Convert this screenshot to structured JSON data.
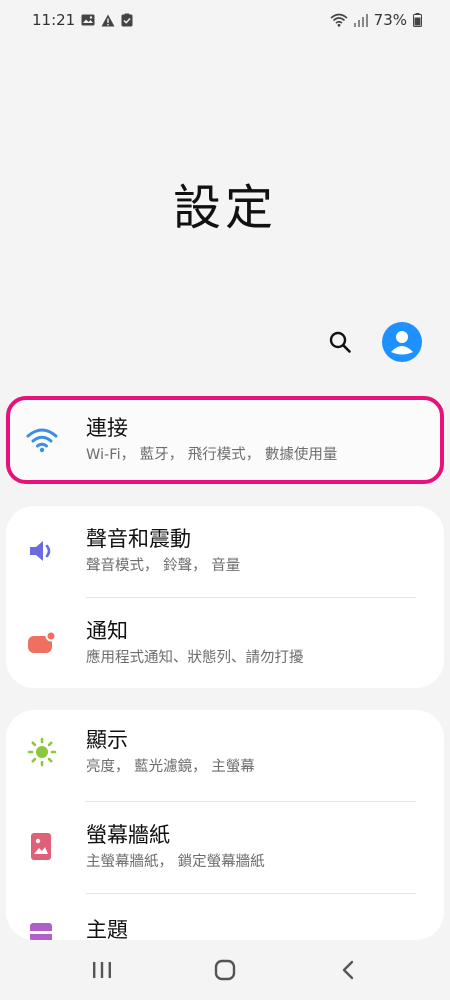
{
  "status_bar": {
    "time": "11:21",
    "left_icons": [
      "image-icon",
      "warning-icon",
      "clipboard-check-icon"
    ],
    "right_icons": [
      "wifi-icon",
      "signal-icon",
      "battery-icon"
    ],
    "battery": "73%"
  },
  "header": {
    "title": "設定"
  },
  "actions": {
    "search_icon": "search-icon",
    "profile_icon": "account-icon",
    "profile_color": "#1e90ff"
  },
  "settings": {
    "connections": {
      "title": "連接",
      "subtitle": "Wi-Fi， 藍牙， 飛行模式， 數據使用量",
      "icon": "wifi-icon",
      "icon_color": "#3a8ee6",
      "highlight_color": "#e8107a"
    },
    "sound": {
      "title": "聲音和震動",
      "subtitle": "聲音模式， 鈴聲， 音量",
      "icon": "volume-icon",
      "icon_color": "#6b6be0"
    },
    "notifications": {
      "title": "通知",
      "subtitle": "應用程式通知、狀態列、請勿打擾",
      "icon": "notification-icon",
      "icon_color": "#f07060"
    },
    "display": {
      "title": "顯示",
      "subtitle": "亮度， 藍光濾鏡， 主螢幕",
      "icon": "brightness-icon",
      "icon_color": "#8bc83a"
    },
    "wallpaper": {
      "title": "螢幕牆紙",
      "subtitle": "主螢幕牆紙， 鎖定螢幕牆紙",
      "icon": "wallpaper-icon",
      "icon_color": "#e0607a"
    },
    "themes": {
      "title": "主題",
      "icon": "themes-icon",
      "icon_color": "#b05fc8"
    }
  },
  "nav_bar": {
    "recents_icon": "recents-icon",
    "home_icon": "home-icon",
    "back_icon": "back-icon"
  }
}
